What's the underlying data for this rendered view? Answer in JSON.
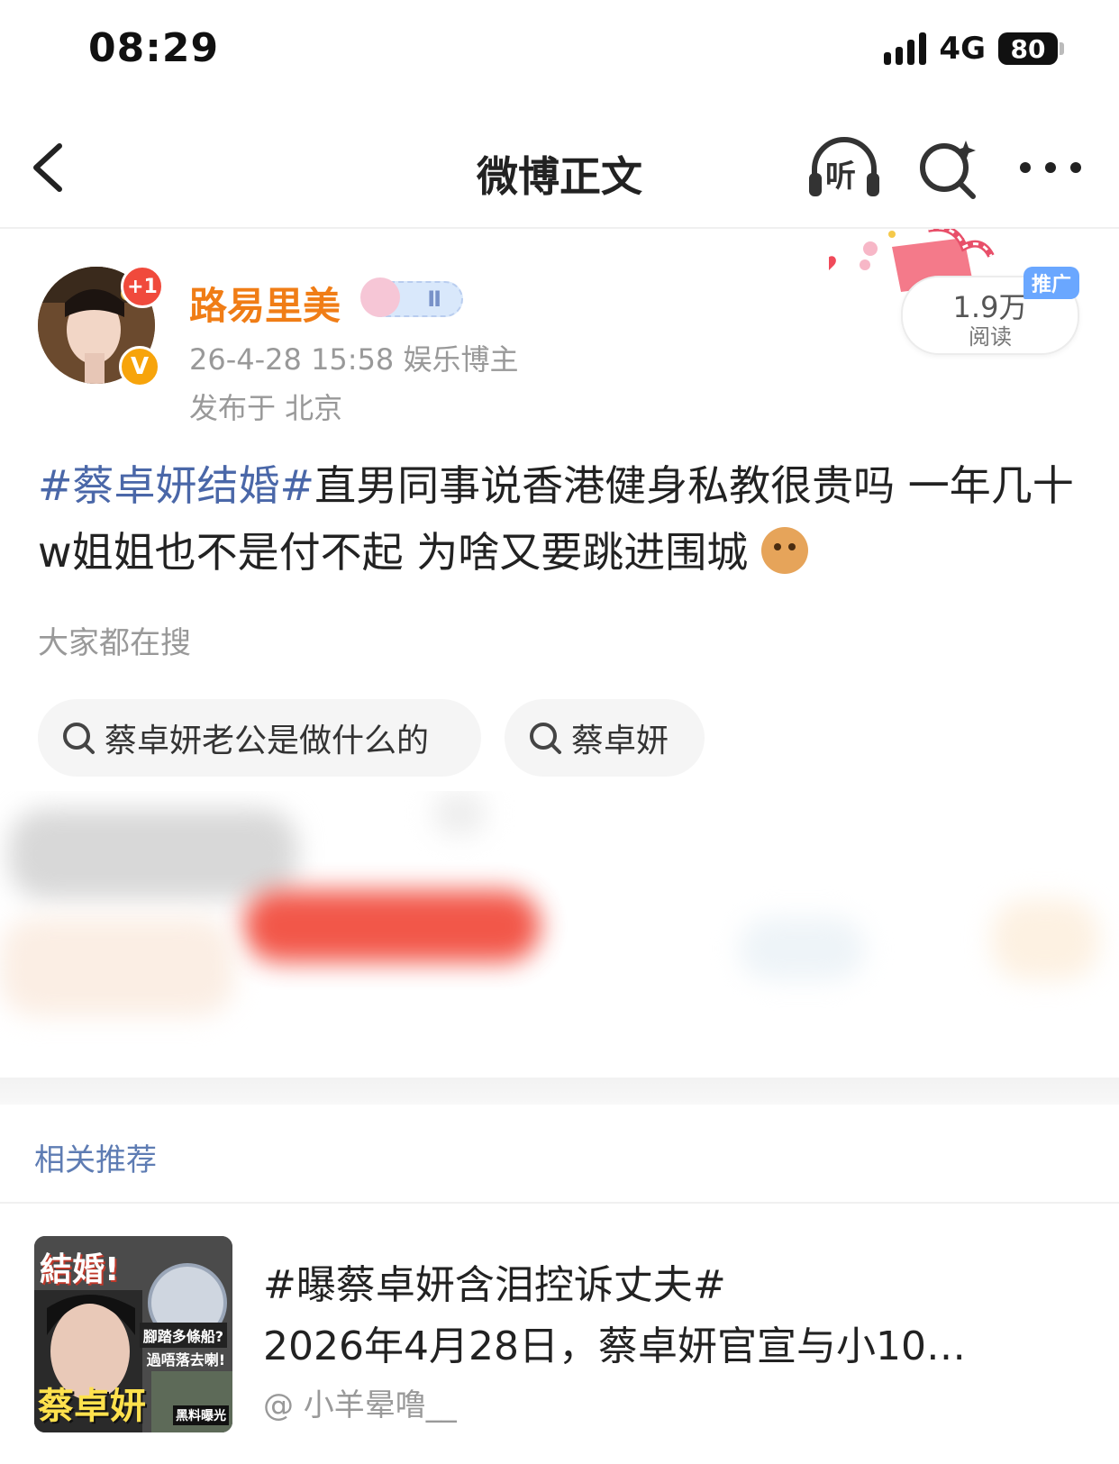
{
  "status_bar": {
    "time": "08:29",
    "network": "4G",
    "battery": "80"
  },
  "nav": {
    "title": "微博正文",
    "listen_label": "听"
  },
  "author": {
    "name": "路易里美",
    "level_badge": "Ⅱ",
    "plus_badge": "+1",
    "verified_badge": "V",
    "meta": "26-4-28 15:58  娱乐博主",
    "location": "发布于 北京"
  },
  "stats": {
    "read_count": "1.9万",
    "read_label": "阅读",
    "promo_tag": "推广"
  },
  "post": {
    "hashtag": "#蔡卓妍结婚#",
    "text": "直男同事说香港健身私教很贵吗 一年几十w姐姐也不是付不起 为啥又要跳进围城"
  },
  "hot_search": {
    "label": "大家都在搜",
    "items": [
      {
        "text": "蔡卓妍老公是做什么的"
      },
      {
        "text": "蔡卓妍"
      }
    ]
  },
  "related": {
    "title": "相关推荐",
    "items": [
      {
        "thumb_title": "結婚!",
        "thumb_name": "蔡卓妍",
        "thumb_sub1": "腳踏多條船?",
        "thumb_sub2": "過唔落去喇!",
        "thumb_tag": "黑料曝光",
        "line1": "#曝蔡卓妍含泪控诉丈夫#",
        "line2": "2026年4月28日，蔡卓妍官宣与小10…",
        "author": "@ 小羊晕噜__"
      }
    ]
  },
  "colors": {
    "accent_orange": "#f07d16",
    "hashtag_blue": "#4a67a8",
    "related_blue": "#5e7cb3",
    "promo_blue": "#6aa7ff",
    "badge_red": "#f04a3c",
    "verified_orange": "#f7a40b"
  },
  "icons": [
    "back-arrow-icon",
    "headphones-icon",
    "ai-search-icon",
    "more-dots-icon",
    "search-icon"
  ]
}
